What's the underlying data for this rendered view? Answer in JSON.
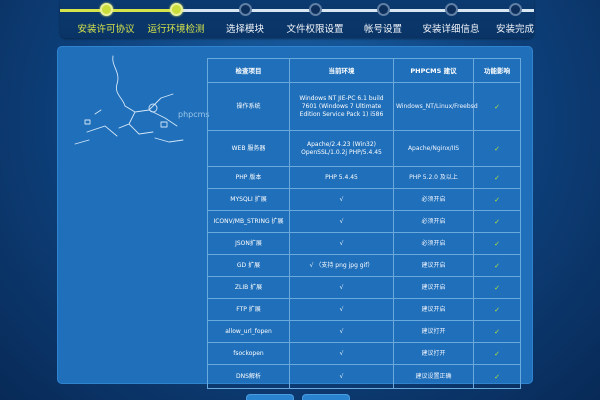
{
  "steps": [
    {
      "label": "安装许可协议",
      "status": "done"
    },
    {
      "label": "运行环境检测",
      "status": "current"
    },
    {
      "label": "选择模块",
      "status": "pending"
    },
    {
      "label": "文件权限设置",
      "status": "pending"
    },
    {
      "label": "帐号设置",
      "status": "pending"
    },
    {
      "label": "安装详细信息",
      "status": "pending"
    },
    {
      "label": "安装完成",
      "status": "pending"
    }
  ],
  "brand": {
    "text": "phpcms"
  },
  "table": {
    "headers": [
      "检查项目",
      "当前环境",
      "PHPCMS 建议",
      "功能影响"
    ],
    "rows": [
      {
        "item": "操作系统",
        "current": "Windows NT JIE-PC 6.1 build 7601 (Windows 7 Ultimate Edition Service Pack 1) i586",
        "recommended": "Windows_NT/Linux/Freebsd",
        "result": "✓"
      },
      {
        "item": "WEB 服务器",
        "current": "Apache/2.4.23 (Win32) OpenSSL/1.0.2j PHP/5.4.45",
        "recommended": "Apache/Nginx/IIS",
        "result": "✓"
      },
      {
        "item": "PHP 版本",
        "current": "PHP 5.4.45",
        "recommended": "PHP 5.2.0 及以上",
        "result": "✓"
      },
      {
        "item": "MYSQLI 扩展",
        "current": "√",
        "recommended": "必须开启",
        "result": "✓"
      },
      {
        "item": "ICONV/MB_STRING 扩展",
        "current": "√",
        "recommended": "必须开启",
        "result": "✓"
      },
      {
        "item": "JSON扩展",
        "current": "√",
        "recommended": "必须开启",
        "result": "✓"
      },
      {
        "item": "GD 扩展",
        "current": "√ （支持 png jpg gif）",
        "recommended": "建议开启",
        "result": "✓"
      },
      {
        "item": "ZLIB 扩展",
        "current": "√",
        "recommended": "建议开启",
        "result": "✓"
      },
      {
        "item": "FTP 扩展",
        "current": "√",
        "recommended": "建议开启",
        "result": "✓"
      },
      {
        "item": "allow_url_fopen",
        "current": "√",
        "recommended": "建议打开",
        "result": "✓"
      },
      {
        "item": "fsockopen",
        "current": "√",
        "recommended": "建议打开",
        "result": "✓"
      },
      {
        "item": "DNS解析",
        "current": "√",
        "recommended": "建议设置正确",
        "result": "✓"
      }
    ]
  },
  "colors": {
    "background": "#0d3f79",
    "panel": "#1f6fba",
    "step_done": "#d5e44b",
    "check_ok": "#b8e334"
  }
}
